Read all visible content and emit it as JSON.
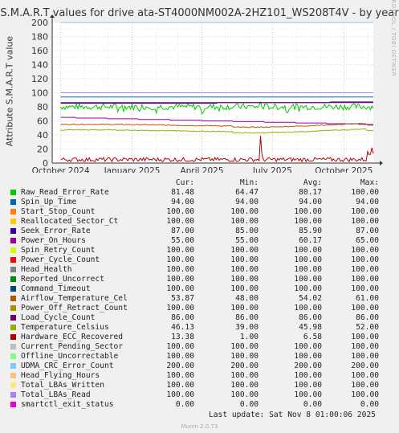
{
  "title": "S.M.A.R.T values for drive ata-ST4000NM002A-2HZ101_WS208T4V - by year",
  "watermark": "RRDTOOL / TOBI OETIKER",
  "footer": {
    "last_update": "Last update: Sat Nov  8 01:00:06 2025",
    "version": "Munin 2.0.73"
  },
  "legend_headers": {
    "cur": "Cur:",
    "min": "Min:",
    "avg": "Avg:",
    "max": "Max:"
  },
  "chart_data": {
    "type": "line",
    "title": "S.M.A.R.T values for drive ata-ST4000NM002A-2HZ101_WS208T4V - by year",
    "ylabel": "Attribute S.M.A.R.T value",
    "xlabel": "",
    "x_ticks": [
      "October 2024",
      "January 2025",
      "April 2025",
      "July 2025",
      "October 2025"
    ],
    "y_ticks": [
      0,
      20,
      40,
      60,
      80,
      100,
      120,
      140,
      160,
      180,
      200
    ],
    "ylim": [
      0,
      200
    ],
    "xlim": [
      "2024-09-20",
      "2025-11-08"
    ],
    "grid": true,
    "series": [
      {
        "name": "Raw_Read_Error_Rate",
        "color": "#00cc00",
        "cur": "81.48",
        "min": "64.47",
        "avg": "80.17",
        "max": "100.00"
      },
      {
        "name": "Spin_Up_Time",
        "color": "#0066b3",
        "cur": "94.00",
        "min": "94.00",
        "avg": "94.00",
        "max": "94.00"
      },
      {
        "name": "Start_Stop_Count",
        "color": "#ff8000",
        "cur": "100.00",
        "min": "100.00",
        "avg": "100.00",
        "max": "100.00"
      },
      {
        "name": "Reallocated_Sector_Ct",
        "color": "#ffcc00",
        "cur": "100.00",
        "min": "100.00",
        "avg": "100.00",
        "max": "100.00"
      },
      {
        "name": "Seek_Error_Rate",
        "color": "#330099",
        "cur": "87.00",
        "min": "85.00",
        "avg": "85.90",
        "max": "87.00"
      },
      {
        "name": "Power_On_Hours",
        "color": "#990099",
        "cur": "55.00",
        "min": "55.00",
        "avg": "60.17",
        "max": "65.00"
      },
      {
        "name": "Spin_Retry_Count",
        "color": "#ccff00",
        "cur": "100.00",
        "min": "100.00",
        "avg": "100.00",
        "max": "100.00"
      },
      {
        "name": "Power_Cycle_Count",
        "color": "#ff0000",
        "cur": "100.00",
        "min": "100.00",
        "avg": "100.00",
        "max": "100.00"
      },
      {
        "name": "Head_Health",
        "color": "#808080",
        "cur": "100.00",
        "min": "100.00",
        "avg": "100.00",
        "max": "100.00"
      },
      {
        "name": "Reported_Uncorrect",
        "color": "#008f00",
        "cur": "100.00",
        "min": "100.00",
        "avg": "100.00",
        "max": "100.00"
      },
      {
        "name": "Command_Timeout",
        "color": "#00487d",
        "cur": "100.00",
        "min": "100.00",
        "avg": "100.00",
        "max": "100.00"
      },
      {
        "name": "Airflow_Temperature_Cel",
        "color": "#b35a00",
        "cur": "53.87",
        "min": "48.00",
        "avg": "54.02",
        "max": "61.00"
      },
      {
        "name": "Power_Off_Retract_Count",
        "color": "#b38f00",
        "cur": "100.00",
        "min": "100.00",
        "avg": "100.00",
        "max": "100.00"
      },
      {
        "name": "Load_Cycle_Count",
        "color": "#6b006b",
        "cur": "86.00",
        "min": "86.00",
        "avg": "86.00",
        "max": "86.00"
      },
      {
        "name": "Temperature_Celsius",
        "color": "#8fb300",
        "cur": "46.13",
        "min": "39.00",
        "avg": "45.98",
        "max": "52.00"
      },
      {
        "name": "Hardware_ECC_Recovered",
        "color": "#b30000",
        "cur": "13.38",
        "min": "1.00",
        "avg": "6.58",
        "max": "100.00"
      },
      {
        "name": "Current_Pending_Sector",
        "color": "#bebebe",
        "cur": "100.00",
        "min": "100.00",
        "avg": "100.00",
        "max": "100.00"
      },
      {
        "name": "Offline_Uncorrectable",
        "color": "#80ff80",
        "cur": "100.00",
        "min": "100.00",
        "avg": "100.00",
        "max": "100.00"
      },
      {
        "name": "UDMA_CRC_Error_Count",
        "color": "#80c9ff",
        "cur": "200.00",
        "min": "200.00",
        "avg": "200.00",
        "max": "200.00"
      },
      {
        "name": "Head_Flying_Hours",
        "color": "#ffc080",
        "cur": "100.00",
        "min": "100.00",
        "avg": "100.00",
        "max": "100.00"
      },
      {
        "name": "Total_LBAs_Written",
        "color": "#ffe680",
        "cur": "100.00",
        "min": "100.00",
        "avg": "100.00",
        "max": "100.00"
      },
      {
        "name": "Total_LBAs_Read",
        "color": "#aa80ff",
        "cur": "100.00",
        "min": "100.00",
        "avg": "100.00",
        "max": "100.00"
      },
      {
        "name": "smartctl_exit_status",
        "color": "#ee00cc",
        "cur": "0.00",
        "min": "0.00",
        "avg": "0.00",
        "max": "0.00"
      }
    ]
  }
}
